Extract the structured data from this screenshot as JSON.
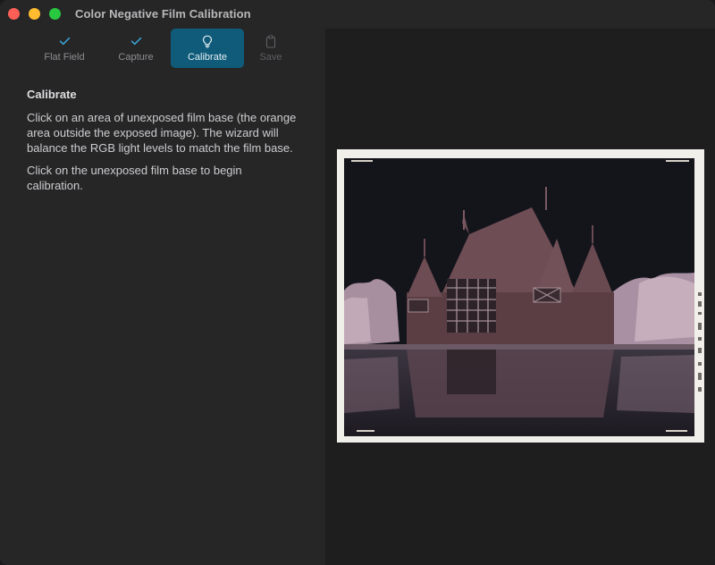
{
  "window": {
    "title": "Color Negative Film Calibration"
  },
  "steps": [
    {
      "label": "Flat Field",
      "state": "done",
      "icon": "checkmark-icon"
    },
    {
      "label": "Capture",
      "state": "done",
      "icon": "checkmark-icon"
    },
    {
      "label": "Calibrate",
      "state": "active",
      "icon": "lightbulb-icon"
    },
    {
      "label": "Save",
      "state": "disabled",
      "icon": "clipboard-icon"
    }
  ],
  "content": {
    "heading": "Calibrate",
    "paragraph1": "Click on an area of unexposed film base (the orange area outside the exposed image). The wizard will balance the RGB light levels to match the film base.",
    "paragraph2": "Click on the unexposed film base to begin calibration."
  },
  "colors": {
    "accent": "#0f5b79",
    "check": "#3aa6d8",
    "window_bg": "#262627",
    "preview_bg": "#1e1e1f"
  },
  "preview": {
    "image": "color-negative-film-scan"
  }
}
